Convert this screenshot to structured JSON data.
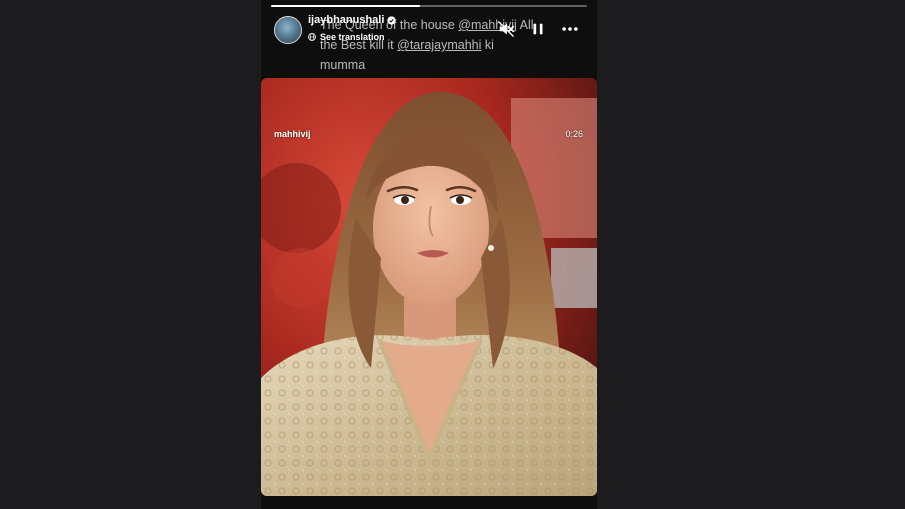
{
  "story": {
    "progress_fraction": 0.47,
    "username": "ijaybhanushali",
    "caption": {
      "text_before": "The Queen of the house ",
      "mention_1": "@mahhivij",
      "text_middle": " All the Best kill it ",
      "mention_2": "@tarajaymahhi",
      "text_after": " ki mumma"
    },
    "see_translation": "See translation",
    "controls": {
      "mute_icon": "mute-icon",
      "pause_icon": "pause-icon",
      "more_icon": "more-icon"
    }
  },
  "video": {
    "username": "mahhivij",
    "timestamp": "0:26"
  },
  "colors": {
    "page_background": "#1c1c1e",
    "story_background": "#0e0e0e",
    "set_red": "#b23226",
    "outfit_gold": "#d8c9a8"
  }
}
